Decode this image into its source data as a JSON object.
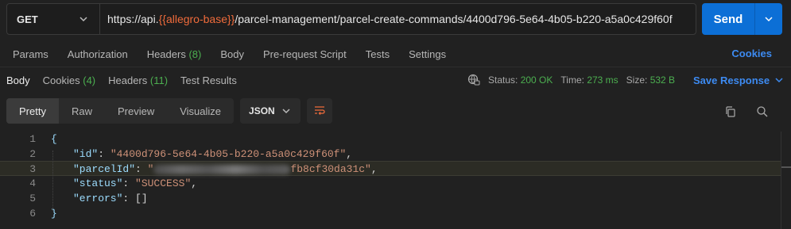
{
  "request": {
    "method": "GET",
    "url_prefix": "https://api.",
    "url_variable": "{{allegro-base}}",
    "url_suffix": "/parcel-management/parcel-create-commands/4400d796-5e64-4b05-b220-a5a0c429f60f",
    "send_label": "Send"
  },
  "request_tabs": [
    {
      "label": "Params",
      "count": ""
    },
    {
      "label": "Authorization",
      "count": ""
    },
    {
      "label": "Headers",
      "count": "(8)"
    },
    {
      "label": "Body",
      "count": ""
    },
    {
      "label": "Pre-request Script",
      "count": ""
    },
    {
      "label": "Tests",
      "count": ""
    },
    {
      "label": "Settings",
      "count": ""
    }
  ],
  "cookies_link": "Cookies",
  "response_tabs": [
    {
      "label": "Body",
      "count": ""
    },
    {
      "label": "Cookies",
      "count": "(4)"
    },
    {
      "label": "Headers",
      "count": "(11)"
    },
    {
      "label": "Test Results",
      "count": ""
    }
  ],
  "response_stats": {
    "status_label": "Status:",
    "status_value": "200 OK",
    "time_label": "Time:",
    "time_value": "273 ms",
    "size_label": "Size:",
    "size_value": "532 B"
  },
  "save_response": "Save Response",
  "view_modes": [
    "Pretty",
    "Raw",
    "Preview",
    "Visualize"
  ],
  "active_view": "Pretty",
  "format": "JSON",
  "body_lines": [
    {
      "num": "1",
      "key": "",
      "value": "",
      "prefix": "{",
      "suffix": ""
    },
    {
      "num": "2",
      "key": "\"id\"",
      "value": "\"4400d796-5e64-4b05-b220-a5a0c429f60f\"",
      "suffix": ","
    },
    {
      "num": "3",
      "key": "\"parcelId\"",
      "value_start": "\"",
      "value_end": "fb8cf30da31c\"",
      "suffix": ","
    },
    {
      "num": "4",
      "key": "\"status\"",
      "value": "\"SUCCESS\"",
      "suffix": ","
    },
    {
      "num": "5",
      "key": "\"errors\"",
      "value": "[]",
      "suffix": ""
    },
    {
      "num": "6",
      "key": "",
      "value": "",
      "prefix": "}",
      "suffix": ""
    }
  ],
  "colors": {
    "accent": "#0c6fd6",
    "link": "#3d8bf2",
    "success": "#4caf50",
    "url_variable": "#ef6b3b",
    "json_key": "#9cdcfe",
    "json_string": "#ce9178"
  }
}
